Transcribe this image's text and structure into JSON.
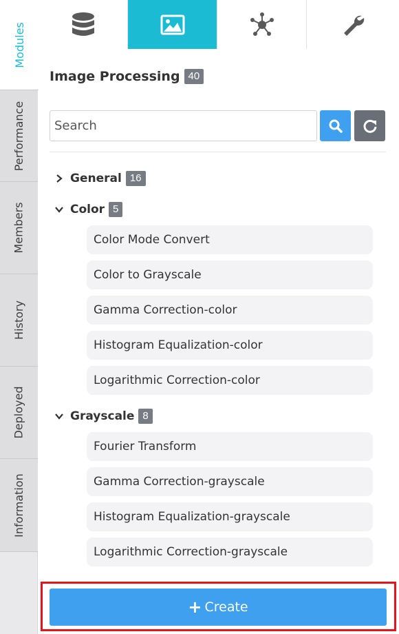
{
  "side_tabs": [
    {
      "label": "Modules",
      "active": true
    },
    {
      "label": "Performance",
      "active": false
    },
    {
      "label": "Members",
      "active": false
    },
    {
      "label": "History",
      "active": false
    },
    {
      "label": "Deployed",
      "active": false
    },
    {
      "label": "Information",
      "active": false
    }
  ],
  "top_tabs": [
    {
      "icon": "database-icon",
      "active": false
    },
    {
      "icon": "image-icon",
      "active": true
    },
    {
      "icon": "network-icon",
      "active": false
    },
    {
      "icon": "wrench-icon",
      "active": false
    }
  ],
  "panel": {
    "title": "Image Processing",
    "count": "40"
  },
  "search": {
    "placeholder": "Search",
    "value": ""
  },
  "groups": [
    {
      "name": "General",
      "count": "16",
      "expanded": false,
      "items": []
    },
    {
      "name": "Color",
      "count": "5",
      "expanded": true,
      "items": [
        "Color Mode Convert",
        "Color to Grayscale",
        "Gamma Correction-color",
        "Histogram Equalization-color",
        "Logarithmic Correction-color"
      ]
    },
    {
      "name": "Grayscale",
      "count": "8",
      "expanded": true,
      "items": [
        "Fourier Transform",
        "Gamma Correction-grayscale",
        "Histogram Equalization-grayscale",
        "Logarithmic Correction-grayscale"
      ]
    }
  ],
  "create_button": {
    "label": "Create",
    "icon": "plus-icon"
  },
  "colors": {
    "accent": "#1bbcd3",
    "primary_button": "#3ea0ef",
    "secondary_button": "#6a6f77",
    "badge": "#777c84",
    "highlight_frame": "#e3141b"
  }
}
